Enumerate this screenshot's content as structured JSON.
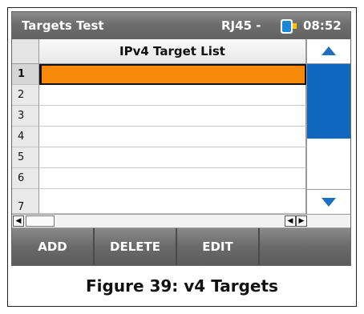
{
  "titlebar": {
    "title": "Targets  Test",
    "status": "RJ45 -",
    "time": "08:52",
    "battery_icon": "battery-icon"
  },
  "table": {
    "header": "IPv4 Target List",
    "rows": [
      {
        "num": "1",
        "value": "",
        "selected": true
      },
      {
        "num": "2",
        "value": ""
      },
      {
        "num": "3",
        "value": ""
      },
      {
        "num": "4",
        "value": ""
      },
      {
        "num": "5",
        "value": ""
      },
      {
        "num": "6",
        "value": ""
      },
      {
        "num": "7",
        "value": ""
      }
    ]
  },
  "toolbar": {
    "add_label": "ADD",
    "delete_label": "DELETE",
    "edit_label": "EDIT",
    "blank_label": ""
  },
  "caption": "Figure 39: v4 Targets",
  "colors": {
    "selection": "#f88a0a",
    "scroll_thumb": "#1067bf",
    "accent_blue": "#1a6fc0",
    "bar_gray": "#6e6e6e"
  }
}
